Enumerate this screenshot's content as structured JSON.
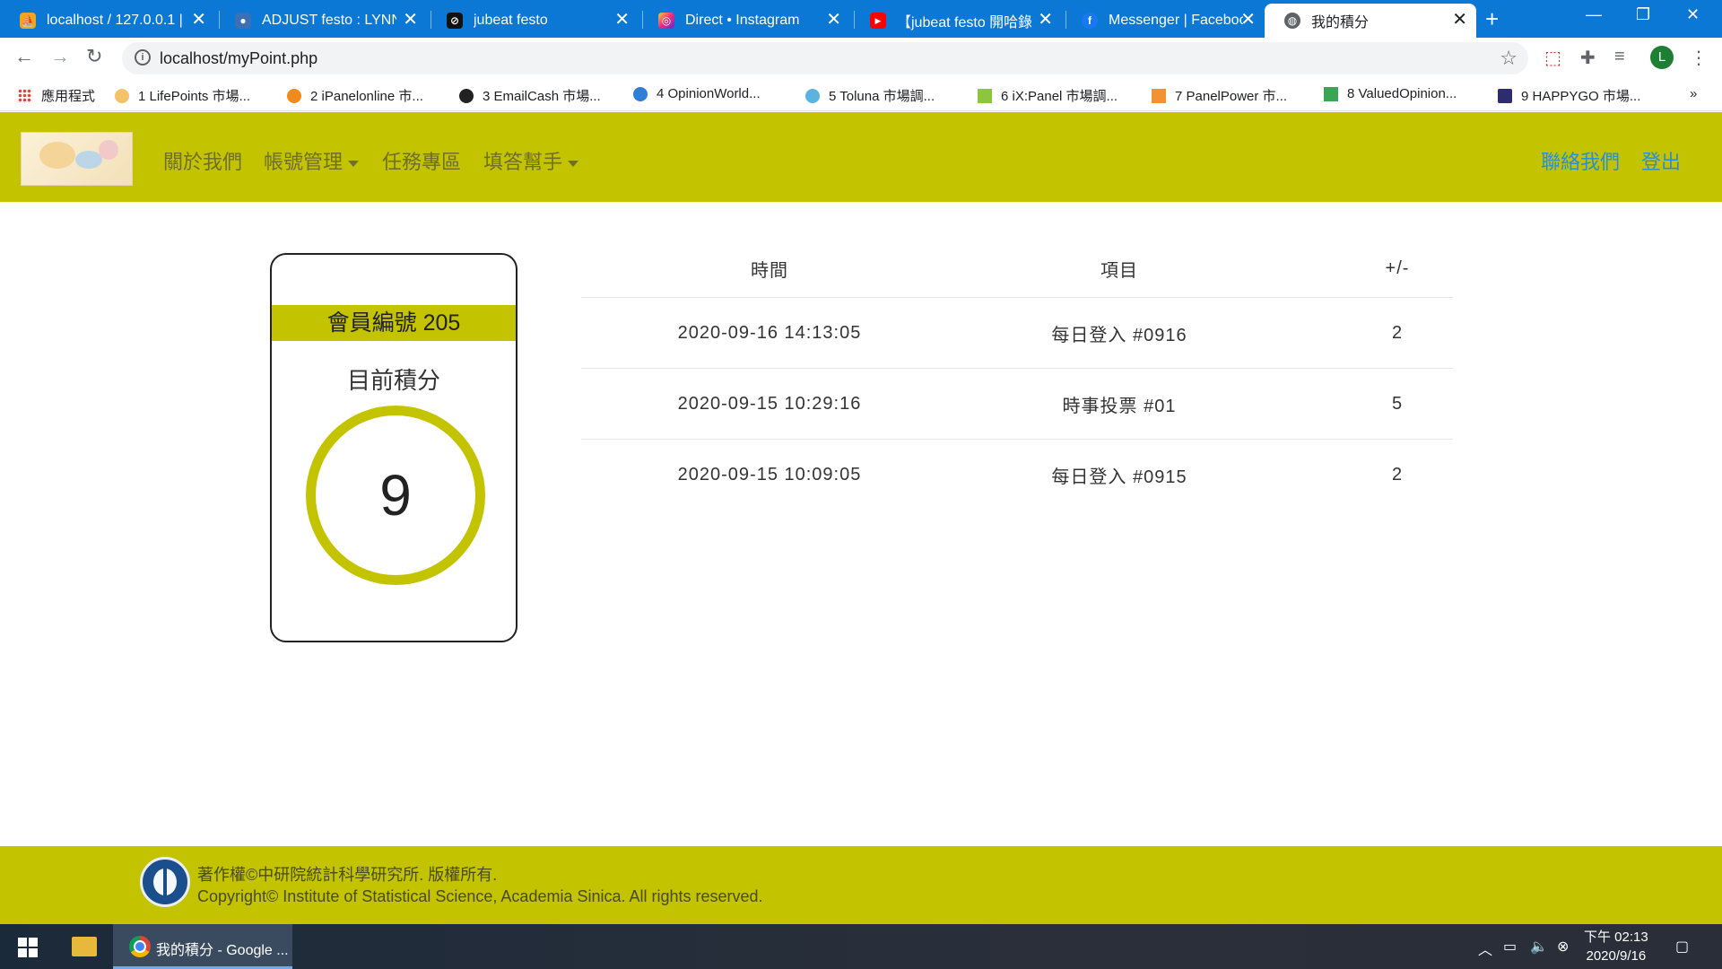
{
  "browser": {
    "tabs": [
      {
        "title": "localhost / 127.0.0.1 |"
      },
      {
        "title": "ADJUST festo : LYNN."
      },
      {
        "title": "jubeat festo"
      },
      {
        "title": "Direct • Instagram"
      },
      {
        "title": "【jubeat festo 開哈錄"
      },
      {
        "title": "Messenger | Faceboo"
      },
      {
        "title": "我的積分"
      }
    ],
    "url": "localhost/myPoint.php",
    "avatar_letter": "L",
    "bookmarks": [
      {
        "label": "應用程式"
      },
      {
        "label": "1   LifePoints 市場..."
      },
      {
        "label": "2   iPanelonline 市..."
      },
      {
        "label": "3   EmailCash 市場..."
      },
      {
        "label": "4   OpinionWorld..."
      },
      {
        "label": "5   Toluna 市場調..."
      },
      {
        "label": "6   iX:Panel 市場調..."
      },
      {
        "label": "7   PanelPower 市..."
      },
      {
        "label": "8   ValuedOpinion..."
      },
      {
        "label": "9   HAPPYGO 市場..."
      }
    ],
    "bookmarks_more": "»"
  },
  "nav": {
    "about": "關於我們",
    "account": "帳號管理",
    "tasks": "任務專區",
    "helper": "填答幫手",
    "contact": "聯絡我們",
    "logout": "登出"
  },
  "card": {
    "member": "會員編號 205",
    "label": "目前積分",
    "points": "9"
  },
  "history": {
    "headers": [
      "時間",
      "項目",
      "+/-"
    ],
    "rows": [
      {
        "time": "2020-09-16 14:13:05",
        "item": "每日登入 #0916",
        "delta": "2"
      },
      {
        "time": "2020-09-15 10:29:16",
        "item": "時事投票 #01",
        "delta": "5"
      },
      {
        "time": "2020-09-15 10:09:05",
        "item": "每日登入 #0915",
        "delta": "2"
      }
    ]
  },
  "footer": {
    "line1": "著作權©中研院統計科學研究所. 版權所有.",
    "line2": "Copyright© Institute of Statistical Science, Academia Sinica. All rights reserved."
  },
  "taskbar": {
    "app_title": "我的積分 - Google ...",
    "time": "下午 02:13",
    "date": "2020/9/16"
  },
  "colors": {
    "accent": "#c3c300",
    "link": "#2a8fd6",
    "chrome_tabbar": "#0a78d4"
  }
}
